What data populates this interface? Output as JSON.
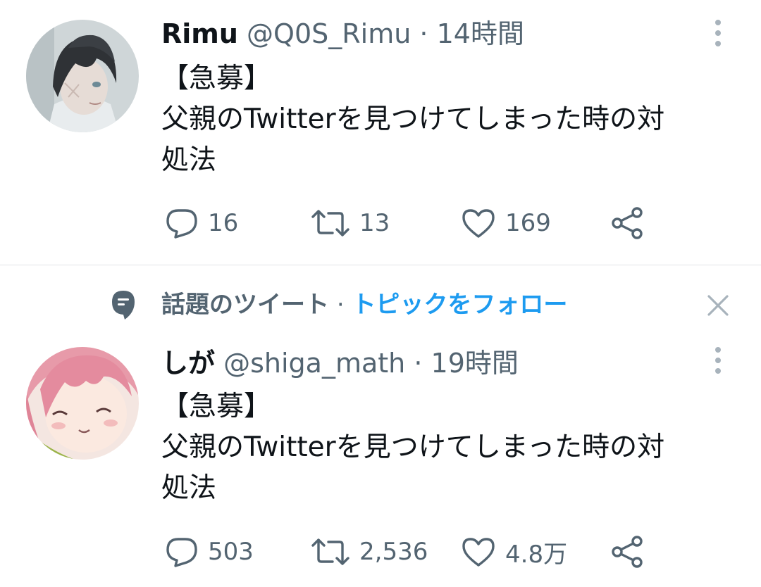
{
  "tweets": [
    {
      "display_name": "Rimu",
      "handle": "@Q0S_Rimu",
      "separator": "·",
      "time": "14時間",
      "text_lines": [
        "【急募】",
        "父親のTwitterを見つけてしまった時の対",
        "処法"
      ],
      "replies": "16",
      "retweets": "13",
      "likes": "169",
      "avatar_icon": "avatar-dark-hair-person"
    },
    {
      "social_context": {
        "label": "話題のツイート",
        "separator": "·",
        "follow_link": "トピックをフォロー",
        "icon": "speech-bubble-icon",
        "dismiss_icon": "close-icon"
      },
      "display_name": "しが",
      "handle": "@shiga_math",
      "separator": "·",
      "time": "19時間",
      "text_lines": [
        "【急募】",
        "父親のTwitterを見つけてしまった時の対",
        "処法"
      ],
      "replies": "503",
      "retweets": "2,536",
      "likes": "4.8万",
      "avatar_icon": "avatar-pink-hair-anime"
    }
  ],
  "colors": {
    "primary_text": "#0f1419",
    "secondary_text": "#536471",
    "accent": "#1d9bf0",
    "divider": "#e1e4e7"
  }
}
